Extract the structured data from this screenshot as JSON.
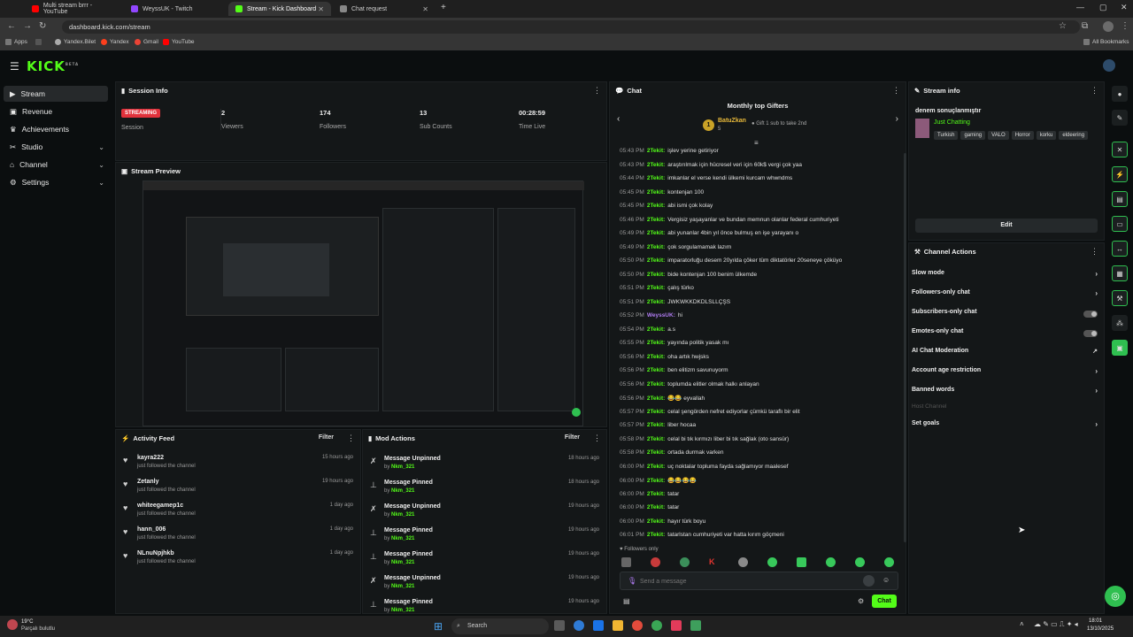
{
  "browser": {
    "tabs": [
      {
        "label": "Multi stream brrr - YouTube",
        "color": "#ff0000"
      },
      {
        "label": "WeyssUK - Twitch",
        "color": "#9146ff"
      },
      {
        "label": "Stream - Kick Dashboard",
        "color": "#53fc18"
      },
      {
        "label": "Chat request",
        "color": "#888888"
      }
    ],
    "url": "dashboard.kick.com/stream",
    "bookmarks": [
      "Apps",
      "Yandex.Bilet",
      "Yandex",
      "Gmail",
      "YouTube"
    ],
    "all_bookmarks": "All Bookmarks"
  },
  "app": {
    "logo": "KICK",
    "logo_sup": "BETA"
  },
  "sidebar": {
    "items": [
      {
        "label": "Stream",
        "icon": "play-icon"
      },
      {
        "label": "Revenue",
        "icon": "wallet-icon"
      },
      {
        "label": "Achievements",
        "icon": "trophy-icon"
      },
      {
        "label": "Studio",
        "icon": "studio-icon"
      },
      {
        "label": "Channel",
        "icon": "channel-icon"
      },
      {
        "label": "Settings",
        "icon": "gear-icon"
      }
    ]
  },
  "session": {
    "title": "Session Info",
    "status_badge": "STREAMING",
    "status_label": "Session",
    "stats": [
      {
        "value": "2",
        "label": "Viewers"
      },
      {
        "value": "174",
        "label": "Followers"
      },
      {
        "value": "13",
        "label": "Sub Counts"
      },
      {
        "value": "00:28:59",
        "label": "Time Live"
      }
    ]
  },
  "preview": {
    "title": "Stream Preview"
  },
  "activity": {
    "title": "Activity Feed",
    "filter": "Filter",
    "items": [
      {
        "user": "kayra222",
        "action": "just followed the channel",
        "time": "15 hours ago"
      },
      {
        "user": "Zetanly",
        "action": "just followed the channel",
        "time": "19 hours ago"
      },
      {
        "user": "whiteegamep1c",
        "action": "just followed the channel",
        "time": "1 day ago"
      },
      {
        "user": "hann_006",
        "action": "just followed the channel",
        "time": "1 day ago"
      },
      {
        "user": "NLnuNpjhkb",
        "action": "just followed the channel",
        "time": "1 day ago"
      }
    ]
  },
  "mod": {
    "title": "Mod Actions",
    "filter": "Filter",
    "items": [
      {
        "action": "Message Unpinned",
        "by": "by",
        "user": "Nkm_321",
        "time": "18 hours ago"
      },
      {
        "action": "Message Pinned",
        "by": "by",
        "user": "Nkm_321",
        "time": "18 hours ago"
      },
      {
        "action": "Message Unpinned",
        "by": "by",
        "user": "Nkm_321",
        "time": "19 hours ago"
      },
      {
        "action": "Message Pinned",
        "by": "by",
        "user": "Nkm_321",
        "time": "19 hours ago"
      },
      {
        "action": "Message Pinned",
        "by": "by",
        "user": "Nkm_321",
        "time": "19 hours ago"
      },
      {
        "action": "Message Unpinned",
        "by": "by",
        "user": "Nkm_321",
        "time": "19 hours ago"
      },
      {
        "action": "Message Pinned",
        "by": "by",
        "user": "Nkm_321",
        "time": "19 hours ago"
      }
    ]
  },
  "chat": {
    "title": "Chat",
    "gifters_title": "Monthly top Gifters",
    "gifter_name": "BatuZkan",
    "gifter_count": "5",
    "gifter_hint": "Gift 1 sub to take 2nd",
    "messages": [
      {
        "time": "05:43 PM",
        "user": "2Tekit:",
        "text": "işlev yerine getiriyor"
      },
      {
        "time": "05:43 PM",
        "user": "2Tekit:",
        "text": "araştırılmak için hücresel veri için 60k$ vergi çok yaa"
      },
      {
        "time": "05:44 PM",
        "user": "2Tekit:",
        "text": "imkanlar el verse kendi ülkemi kurcam whwndms"
      },
      {
        "time": "05:45 PM",
        "user": "2Tekit:",
        "text": "kontenjan 100"
      },
      {
        "time": "05:45 PM",
        "user": "2Tekit:",
        "text": "abi ismi çok kolay"
      },
      {
        "time": "05:46 PM",
        "user": "2Tekit:",
        "text": "Vergisiz yaşayanlar ve bundan memnun olanlar federal cumhuriyeti"
      },
      {
        "time": "05:49 PM",
        "user": "2Tekit:",
        "text": "abi yunanlar 4bin yıl önce bulmuş en işe yarayanı o"
      },
      {
        "time": "05:49 PM",
        "user": "2Tekit:",
        "text": "çok sorgulamamak lazım"
      },
      {
        "time": "05:50 PM",
        "user": "2Tekit:",
        "text": "imparatorluğu desem 20yılda çöker tüm diktatörler 20seneye çöküyo"
      },
      {
        "time": "05:50 PM",
        "user": "2Tekit:",
        "text": "bide kontenjan 100 benim ülkemde"
      },
      {
        "time": "05:51 PM",
        "user": "2Tekit:",
        "text": "çalış türko"
      },
      {
        "time": "05:51 PM",
        "user": "2Tekit:",
        "text": "JWKWKKDKDLSLLÇŞS"
      },
      {
        "time": "05:52 PM",
        "user": "WeyssUK:",
        "text": "hi",
        "purple": true
      },
      {
        "time": "05:54 PM",
        "user": "2Tekit:",
        "text": "a.s"
      },
      {
        "time": "05:55 PM",
        "user": "2Tekit:",
        "text": "yayında politik yasak mı"
      },
      {
        "time": "05:56 PM",
        "user": "2Tekit:",
        "text": "oha artık hwjsks"
      },
      {
        "time": "05:56 PM",
        "user": "2Tekit:",
        "text": "ben elitizm savunuyorm"
      },
      {
        "time": "05:56 PM",
        "user": "2Tekit:",
        "text": "toplumda elitler olmak halkı anlayan"
      },
      {
        "time": "05:56 PM",
        "user": "2Tekit:",
        "text": "😂😂 eyvallah"
      },
      {
        "time": "05:57 PM",
        "user": "2Tekit:",
        "text": "celal şengörden nefret ediyorlar çümkü taraflı bir elit"
      },
      {
        "time": "05:57 PM",
        "user": "2Tekit:",
        "text": "liber hocaa"
      },
      {
        "time": "05:58 PM",
        "user": "2Tekit:",
        "text": "celal bi tık kırmızı liber bi tık sağlak (oto sansür)"
      },
      {
        "time": "05:58 PM",
        "user": "2Tekit:",
        "text": "ortada durmak varken"
      },
      {
        "time": "06:00 PM",
        "user": "2Tekit:",
        "text": "uç noktalar topluma fayda sağlamıyor maalesef"
      },
      {
        "time": "06:00 PM",
        "user": "2Tekit:",
        "text": "😂😂😂😂"
      },
      {
        "time": "06:00 PM",
        "user": "2Tekit:",
        "text": "tatar"
      },
      {
        "time": "06:00 PM",
        "user": "2Tekit:",
        "text": "tatar"
      },
      {
        "time": "06:00 PM",
        "user": "2Tekit:",
        "text": "hayır türk boyu"
      },
      {
        "time": "06:01 PM",
        "user": "2Tekit:",
        "text": "tatarlstan cumhuriyeti var hatta kırım göçmeni"
      }
    ],
    "followers_only": "Followers only",
    "input_placeholder": "Send a message",
    "send_label": "Chat"
  },
  "stream_info": {
    "title": "Stream info",
    "stream_title": "denem sonuçlanmıştır",
    "category": "Just Chatting",
    "tags": [
      "Turkish",
      "gaming",
      "VALO",
      "Horror",
      "korku",
      "eldeering"
    ],
    "edit_label": "Edit"
  },
  "channel_actions": {
    "title": "Channel Actions",
    "items": [
      {
        "label": "Slow mode",
        "control": "chevron"
      },
      {
        "label": "Followers-only chat",
        "control": "chevron"
      },
      {
        "label": "Subscribers-only chat",
        "control": "toggle"
      },
      {
        "label": "Emotes-only chat",
        "control": "toggle"
      },
      {
        "label": "AI Chat Moderation",
        "control": "external"
      },
      {
        "label": "Account age restriction",
        "control": "chevron"
      },
      {
        "label": "Banned words",
        "control": "chevron"
      },
      {
        "label": "Host Channel",
        "control": "none",
        "disabled": true
      },
      {
        "label": "Set goals",
        "control": "chevron"
      }
    ]
  },
  "taskbar": {
    "weather_temp": "19°C",
    "weather_desc": "Parçalı bulutlu",
    "search": "Search",
    "time": "18:01",
    "date": "13/10/2025"
  }
}
